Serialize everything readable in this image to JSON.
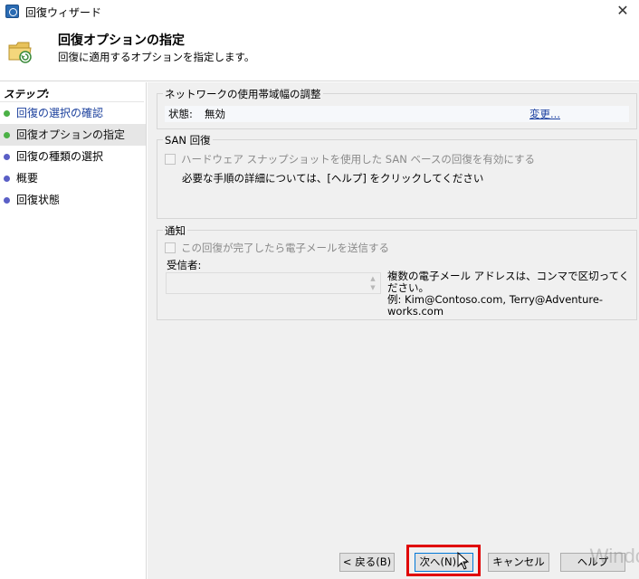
{
  "window": {
    "title": "回復ウィザード",
    "close_glyph": "✕"
  },
  "header": {
    "title": "回復オプションの指定",
    "subtitle": "回復に適用するオプションを指定します。",
    "icon": "folder-restore-icon"
  },
  "sidebar": {
    "heading": "ステップ:",
    "items": [
      {
        "label": "回復の選択の確認",
        "state": "done"
      },
      {
        "label": "回復オプションの指定",
        "state": "current"
      },
      {
        "label": "回復の種類の選択",
        "state": "pending"
      },
      {
        "label": "概要",
        "state": "pending"
      },
      {
        "label": "回復状態",
        "state": "pending"
      }
    ]
  },
  "network": {
    "title": "ネットワークの使用帯域幅の調整",
    "status_label": "状態:",
    "status_value": "無効",
    "change_link": "変更..."
  },
  "san": {
    "title": "SAN 回復",
    "checkbox_label": "ハードウェア スナップショットを使用した SAN ベースの回復を有効にする",
    "checked": false,
    "help_note": "必要な手順の詳細については、[ヘルプ] をクリックしてください"
  },
  "notification": {
    "title": "通知",
    "checkbox_label": "この回復が完了したら電子メールを送信する",
    "checked": false,
    "recipients_label": "受信者:",
    "recipients_value": "",
    "hint_line1": "複数の電子メール アドレスは、コンマで区切ってください。",
    "hint_line2": "例: Kim@Contoso.com, Terry@Adventure-works.com"
  },
  "footer": {
    "back_label": "< 戻る(B)",
    "next_label": "次へ(N) >",
    "cancel_label": "キャンセル",
    "help_label": "ヘルプ",
    "watermark": "Windo"
  },
  "colors": {
    "done_dot": "#4bb146",
    "pending_dot": "#5a5fc6",
    "highlight": "#e00000",
    "link": "#1a3fa0"
  }
}
